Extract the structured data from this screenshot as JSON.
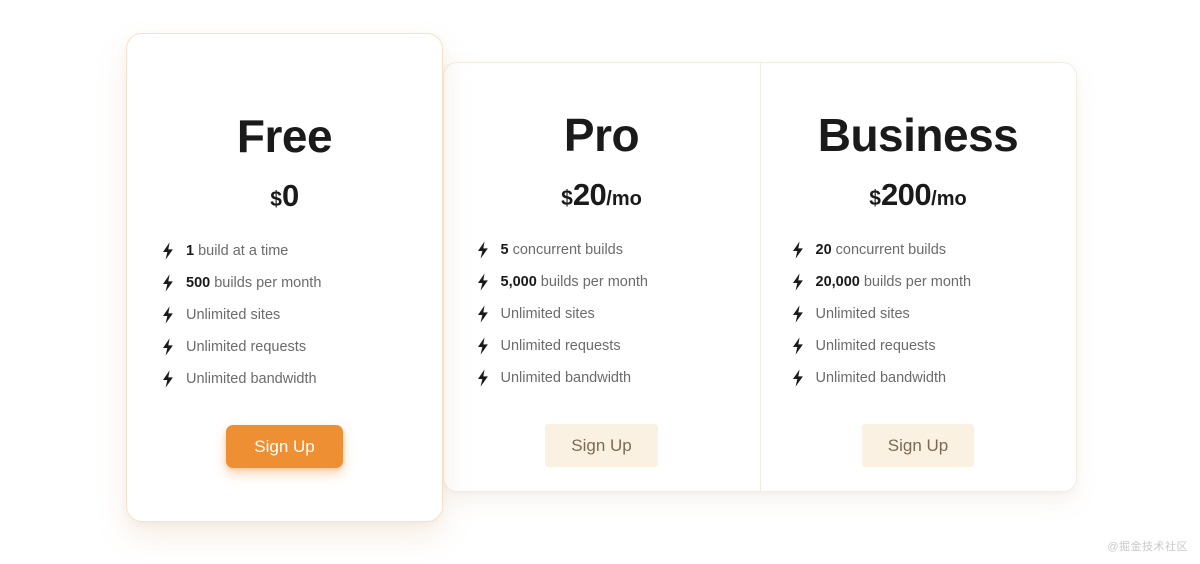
{
  "page": {
    "background_color": "#ffffff",
    "accent_color": "#ef8f34",
    "muted_button_bg": "#fbf1e2",
    "muted_button_text": "#7b6a55",
    "highlight_border_color": "#f6e2cb",
    "panel_border_color": "#f3ece1",
    "feature_text_color": "#6b6b6b",
    "heading_color": "#1a1a1a"
  },
  "watermark": {
    "text": "@掘金技术社区"
  },
  "plans": [
    {
      "id": "free",
      "name": "Free",
      "highlighted": true,
      "price": {
        "currency": "$",
        "amount": "0",
        "period": ""
      },
      "features": [
        {
          "strong": "1",
          "text": "build at a time"
        },
        {
          "strong": "500",
          "text": "builds per month"
        },
        {
          "strong": "",
          "text": "Unlimited sites"
        },
        {
          "strong": "",
          "text": "Unlimited requests"
        },
        {
          "strong": "",
          "text": "Unlimited bandwidth"
        }
      ],
      "cta_label": "Sign Up"
    },
    {
      "id": "pro",
      "name": "Pro",
      "highlighted": false,
      "price": {
        "currency": "$",
        "amount": "20",
        "period": "/mo"
      },
      "features": [
        {
          "strong": "5",
          "text": "concurrent builds"
        },
        {
          "strong": "5,000",
          "text": "builds per month"
        },
        {
          "strong": "",
          "text": "Unlimited sites"
        },
        {
          "strong": "",
          "text": "Unlimited requests"
        },
        {
          "strong": "",
          "text": "Unlimited bandwidth"
        }
      ],
      "cta_label": "Sign Up"
    },
    {
      "id": "business",
      "name": "Business",
      "highlighted": false,
      "price": {
        "currency": "$",
        "amount": "200",
        "period": "/mo"
      },
      "features": [
        {
          "strong": "20",
          "text": "concurrent builds"
        },
        {
          "strong": "20,000",
          "text": "builds per month"
        },
        {
          "strong": "",
          "text": "Unlimited sites"
        },
        {
          "strong": "",
          "text": "Unlimited requests"
        },
        {
          "strong": "",
          "text": "Unlimited bandwidth"
        }
      ],
      "cta_label": "Sign Up"
    }
  ],
  "icons": {
    "bolt": "bolt-icon"
  }
}
